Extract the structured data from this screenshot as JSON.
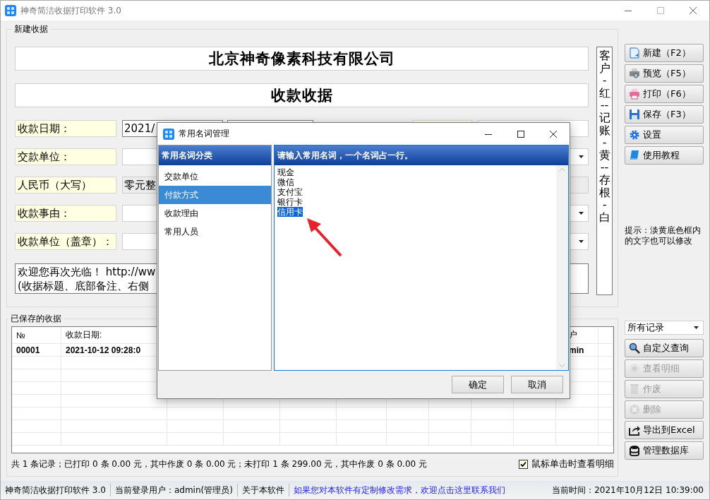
{
  "window": {
    "title": "神奇简洁收据打印软件 3.0"
  },
  "new_receipt": {
    "legend": "新建收据",
    "company": "北京神奇像素科技有限公司",
    "receipt_title": "收款收据",
    "fields": [
      {
        "label": "收款日期：",
        "value": "2021/",
        "kind": "date"
      },
      {
        "label": "交款单位：",
        "kind": "combo"
      },
      {
        "label": "人民币（大写）",
        "value": "零元整",
        "kind": "readonly"
      },
      {
        "label": "收款事由：",
        "kind": "combo"
      },
      {
        "label": "收款单位（盖章）：",
        "kind": "combo"
      }
    ],
    "memo_lines": [
      "欢迎您再次光临！ http://ww",
      "(收据标题、底部备注、右侧"
    ],
    "copies_note": "客户-红--记账-黄--存根-白"
  },
  "actions": [
    {
      "label": "新建（F2）",
      "disabled": false
    },
    {
      "label": "预览（F5）",
      "disabled": false
    },
    {
      "label": "打印（F6）",
      "disabled": false
    },
    {
      "label": "保存（F3）",
      "disabled": false
    },
    {
      "label": "设置",
      "disabled": false
    },
    {
      "label": "使用教程",
      "disabled": false
    }
  ],
  "hint": "提示：淡黄底色框内的文字也可以修改",
  "saved": {
    "legend": "已保存的收据",
    "columns": [
      "№",
      "收款日期:",
      "户"
    ],
    "rows": [
      [
        "00001",
        "2021-10-12 09:28:0",
        "min"
      ]
    ],
    "summary": "共 1 条记录；已打印 0 条 0.00 元，其中作废 0 条 0.00 元；未打印 1 条 299.00 元，其中作废 0 条 0.00 元",
    "click_detail": {
      "label": "鼠标单击时查看明细",
      "checked": true
    }
  },
  "filter": {
    "value": "所有记录"
  },
  "record_actions": [
    {
      "label": "自定义查询",
      "disabled": false
    },
    {
      "label": "查看明细",
      "disabled": true
    },
    {
      "label": "作废",
      "disabled": true
    },
    {
      "label": "删除",
      "disabled": true
    },
    {
      "label": "导出到Excel",
      "disabled": false
    },
    {
      "label": "管理数据库",
      "disabled": false
    }
  ],
  "status_bar": {
    "items": [
      {
        "text": "神奇简洁收据打印软件 3.0",
        "kind": "plain"
      },
      {
        "text": "当前登录用户：admin(管理员)",
        "kind": "plain"
      },
      {
        "text": "关于本软件",
        "kind": "plain"
      },
      {
        "text": "如果您对本软件有定制修改需求，欢迎点击这里联系我们",
        "kind": "link"
      }
    ],
    "time": "当前时间：2021年10月12日 10:39:00"
  },
  "dialog": {
    "title": "常用名词管理",
    "categories_header": "常用名词分类",
    "categories": [
      {
        "label": "交款单位",
        "selected": false
      },
      {
        "label": "付款方式",
        "selected": true
      },
      {
        "label": "收款理由",
        "selected": false
      },
      {
        "label": "常用人员",
        "selected": false
      }
    ],
    "terms_header": "请输入常用名词，一个名词占一行。",
    "terms": [
      {
        "text": "现金",
        "selected": false
      },
      {
        "text": "微信",
        "selected": false
      },
      {
        "text": "支付宝",
        "selected": false
      },
      {
        "text": "银行卡",
        "selected": false
      },
      {
        "text": "信用卡",
        "selected": true
      }
    ],
    "buttons": [
      "确定",
      "取消"
    ]
  }
}
